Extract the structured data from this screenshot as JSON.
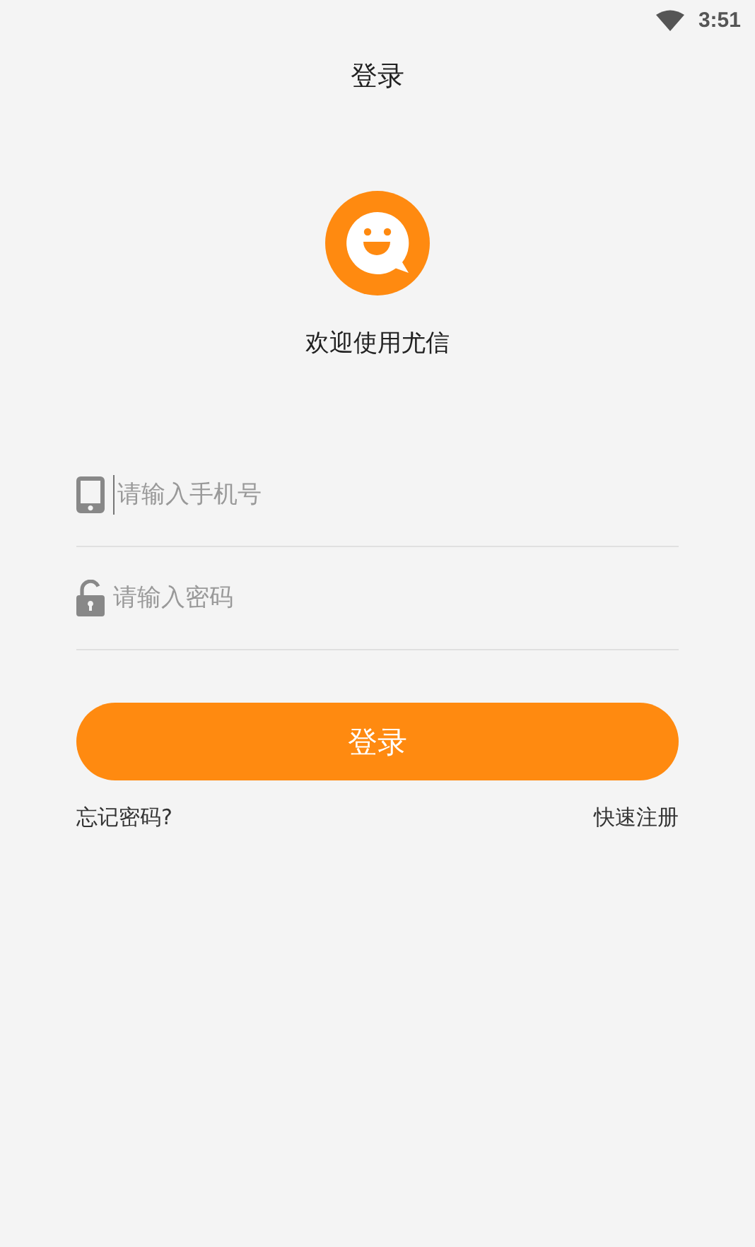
{
  "status_bar": {
    "time": "3:51"
  },
  "header": {
    "title": "登录"
  },
  "welcome": {
    "text": "欢迎使用尤信"
  },
  "fields": [
    {
      "kind": "phone",
      "placeholder": "请输入手机号",
      "focused": true
    },
    {
      "kind": "password",
      "placeholder": "请输入密码",
      "focused": false
    }
  ],
  "login_button": {
    "label": "登录"
  },
  "links": {
    "forgot": "忘记密码?",
    "register": "快速注册"
  }
}
